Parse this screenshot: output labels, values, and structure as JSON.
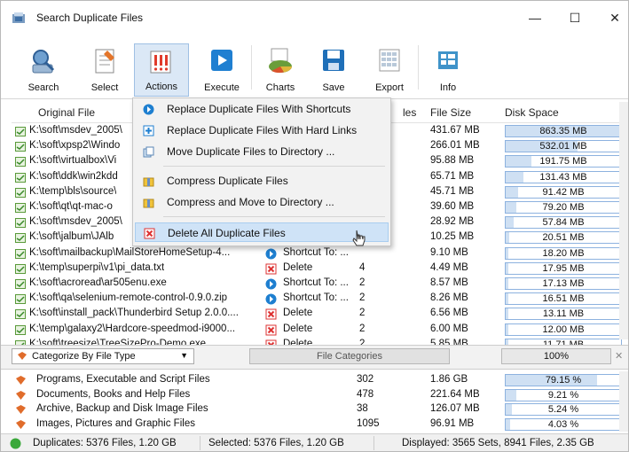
{
  "window": {
    "title": "Search Duplicate Files",
    "minimize": "—",
    "maximize": "☐",
    "close": "✕"
  },
  "toolbar": {
    "buttons": [
      {
        "label": "Search",
        "icon": "search-icon"
      },
      {
        "label": "Select",
        "icon": "select-icon"
      },
      {
        "label": "Actions",
        "icon": "actions-icon",
        "active": true
      },
      {
        "label": "Execute",
        "icon": "execute-icon"
      },
      {
        "label": "Charts",
        "icon": "pie-chart-icon"
      },
      {
        "label": "Save",
        "icon": "save-icon"
      },
      {
        "label": "Export",
        "icon": "export-icon"
      },
      {
        "label": "Info",
        "icon": "info-icon"
      }
    ]
  },
  "grid": {
    "headers": {
      "file": "Original File",
      "files": "les",
      "size": "File Size",
      "disk": "Disk Space"
    },
    "rows": [
      {
        "path": "K:\\soft\\msdev_2005\\",
        "action": "",
        "count": "",
        "size": "431.67 MB",
        "disk": "863.35 MB",
        "fraction": 0.99
      },
      {
        "path": "K:\\soft\\xpsp2\\Windo",
        "action": "",
        "count": "",
        "size": "266.01 MB",
        "disk": "532.01 MB",
        "fraction": 0.62
      },
      {
        "path": "K:\\soft\\virtualbox\\Vi",
        "action": "",
        "count": "",
        "size": "95.88 MB",
        "disk": "191.75 MB",
        "fraction": 0.22
      },
      {
        "path": "K:\\soft\\ddk\\win2kdd",
        "action": "",
        "count": "",
        "size": "65.71 MB",
        "disk": "131.43 MB",
        "fraction": 0.15
      },
      {
        "path": "K:\\temp\\bls\\source\\",
        "action": "",
        "count": "",
        "size": "45.71 MB",
        "disk": "91.42 MB",
        "fraction": 0.11
      },
      {
        "path": "K:\\soft\\qt\\qt-mac-o",
        "action": "",
        "count": "",
        "size": "39.60 MB",
        "disk": "79.20 MB",
        "fraction": 0.09
      },
      {
        "path": "K:\\soft\\msdev_2005\\",
        "action": "",
        "count": "",
        "size": "28.92 MB",
        "disk": "57.84 MB",
        "fraction": 0.07
      },
      {
        "path": "K:\\soft\\jalbum\\JAlb",
        "action": "",
        "count": "",
        "size": "10.25 MB",
        "disk": "20.51 MB",
        "fraction": 0.03
      },
      {
        "path": "K:\\soft\\mailbackup\\MailStoreHomeSetup-4...",
        "action": "Shortcut To: ...",
        "count": "",
        "size": "9.10 MB",
        "disk": "18.20 MB",
        "fraction": 0.025
      },
      {
        "path": "K:\\temp\\superpi\\v1\\pi_data.txt",
        "action": "Delete",
        "count": "4",
        "size": "4.49 MB",
        "disk": "17.95 MB",
        "fraction": 0.025
      },
      {
        "path": "K:\\soft\\acroread\\ar505enu.exe",
        "action": "Shortcut To: ...",
        "count": "2",
        "size": "8.57 MB",
        "disk": "17.13 MB",
        "fraction": 0.02
      },
      {
        "path": "K:\\soft\\qa\\selenium-remote-control-0.9.0.zip",
        "action": "Shortcut To: ...",
        "count": "2",
        "size": "8.26 MB",
        "disk": "16.51 MB",
        "fraction": 0.02
      },
      {
        "path": "K:\\soft\\install_pack\\Thunderbird Setup 2.0.0....",
        "action": "Delete",
        "count": "2",
        "size": "6.56 MB",
        "disk": "13.11 MB",
        "fraction": 0.02
      },
      {
        "path": "K:\\temp\\galaxy2\\Hardcore-speedmod-i9000...",
        "action": "Delete",
        "count": "2",
        "size": "6.00 MB",
        "disk": "12.00 MB",
        "fraction": 0.015
      },
      {
        "path": "K:\\soft\\treesize\\TreeSizePro-Demo.exe",
        "action": "Delete",
        "count": "2",
        "size": "5.85 MB",
        "disk": "11.71 MB",
        "fraction": 0.015
      }
    ]
  },
  "menu": {
    "items": [
      {
        "label": "Replace Duplicate Files With Shortcuts",
        "icon": "shortcut-icon"
      },
      {
        "label": "Replace Duplicate Files With Hard Links",
        "icon": "hard-link-icon"
      },
      {
        "label": "Move Duplicate Files to Directory ...",
        "icon": "move-icon"
      },
      {
        "label": "Compress Duplicate Files",
        "icon": "compress-icon"
      },
      {
        "label": "Compress and Move to Directory ...",
        "icon": "compress-move-icon"
      },
      {
        "label": "Delete All Duplicate Files",
        "icon": "delete-icon",
        "highlighted": true
      }
    ]
  },
  "midbar": {
    "category_select": "Categorize By File Type",
    "categories_button": "File Categories",
    "percent": "100%"
  },
  "categories": [
    {
      "name": "Programs, Executable and Script Files",
      "count": "302",
      "size": "1.86 GB",
      "pct": "79.15 %",
      "fraction": 0.79
    },
    {
      "name": "Documents, Books and Help Files",
      "count": "478",
      "size": "221.64 MB",
      "pct": "9.21 %",
      "fraction": 0.09
    },
    {
      "name": "Archive, Backup and Disk Image Files",
      "count": "38",
      "size": "126.07 MB",
      "pct": "5.24 %",
      "fraction": 0.05
    },
    {
      "name": "Images, Pictures and Graphic Files",
      "count": "1095",
      "size": "96.91 MB",
      "pct": "4.03 %",
      "fraction": 0.04
    }
  ],
  "status": {
    "duplicates": "Duplicates: 5376 Files, 1.20 GB",
    "selected": "Selected: 5376 Files, 1.20 GB",
    "displayed": "Displayed: 3565 Sets, 8941 Files, 2.35 GB"
  },
  "colors": {
    "accent": "#2a7fd4",
    "bar_fill": "#cfe0f3",
    "highlight": "#cfe3f7"
  }
}
